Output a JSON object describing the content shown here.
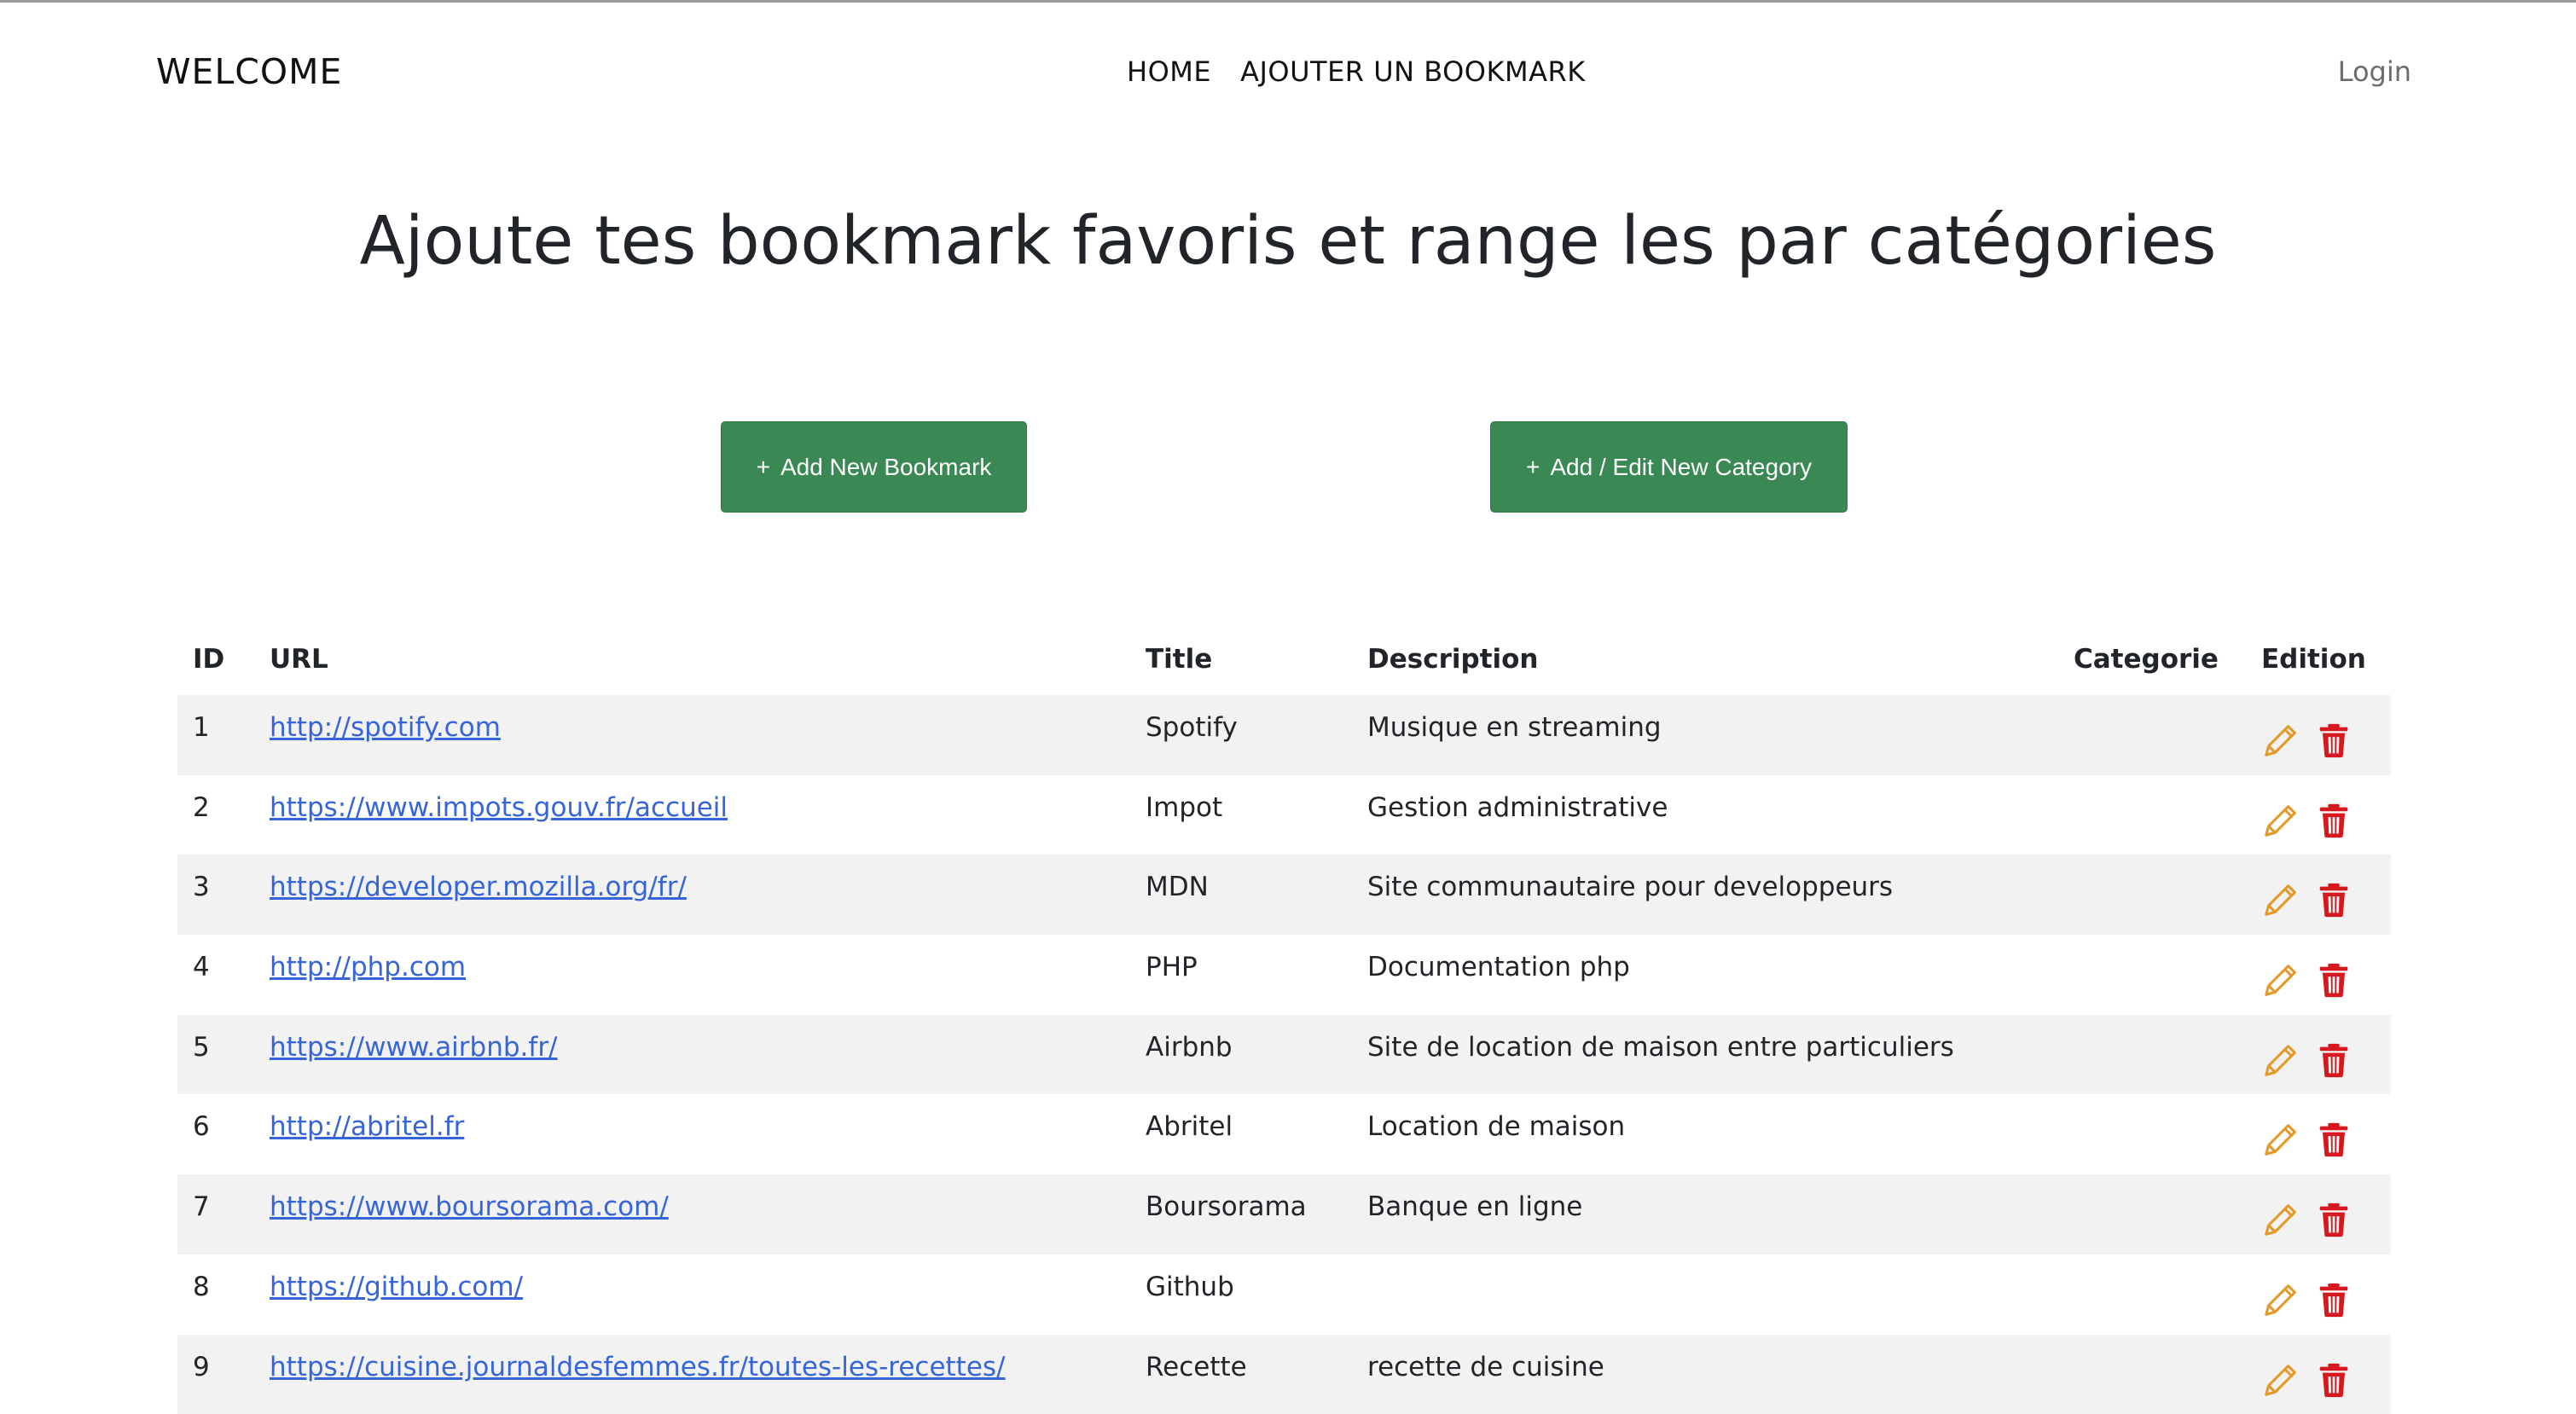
{
  "nav": {
    "brand": "WELCOME",
    "links": [
      "HOME",
      "AJOUTER UN BOOKMARK"
    ],
    "login": "Login"
  },
  "hero": {
    "title": "Ajoute tes bookmark favoris et range les par catégories"
  },
  "actions": {
    "add_bookmark": "Add New Bookmark",
    "add_category": "Add / Edit New Category"
  },
  "colors": {
    "primary_button": "#3a8955",
    "link": "#3565d8",
    "edit_icon": "#e39a2a",
    "delete_icon": "#d7191f",
    "row_stripe": "#f2f2f2"
  },
  "table": {
    "headers": [
      "ID",
      "URL",
      "Title",
      "Description",
      "Categorie",
      "Edition"
    ],
    "rows": [
      {
        "id": "1",
        "url": "http://spotify.com",
        "title": "Spotify",
        "description": "Musique en streaming",
        "category": ""
      },
      {
        "id": "2",
        "url": "https://www.impots.gouv.fr/accueil",
        "title": "Impot",
        "description": "Gestion administrative",
        "category": ""
      },
      {
        "id": "3",
        "url": "https://developer.mozilla.org/fr/",
        "title": "MDN",
        "description": "Site communautaire pour developpeurs",
        "category": ""
      },
      {
        "id": "4",
        "url": "http://php.com",
        "title": "PHP",
        "description": "Documentation php",
        "category": ""
      },
      {
        "id": "5",
        "url": "https://www.airbnb.fr/",
        "title": "Airbnb",
        "description": "Site de location de maison entre particuliers",
        "category": ""
      },
      {
        "id": "6",
        "url": "http://abritel.fr",
        "title": "Abritel",
        "description": "Location de maison",
        "category": ""
      },
      {
        "id": "7",
        "url": "https://www.boursorama.com/",
        "title": "Boursorama",
        "description": "Banque en ligne",
        "category": ""
      },
      {
        "id": "8",
        "url": "https://github.com/",
        "title": "Github",
        "description": "",
        "category": ""
      },
      {
        "id": "9",
        "url": "https://cuisine.journaldesfemmes.fr/toutes-les-recettes/",
        "title": "Recette",
        "description": "recette de cuisine",
        "category": ""
      }
    ]
  }
}
